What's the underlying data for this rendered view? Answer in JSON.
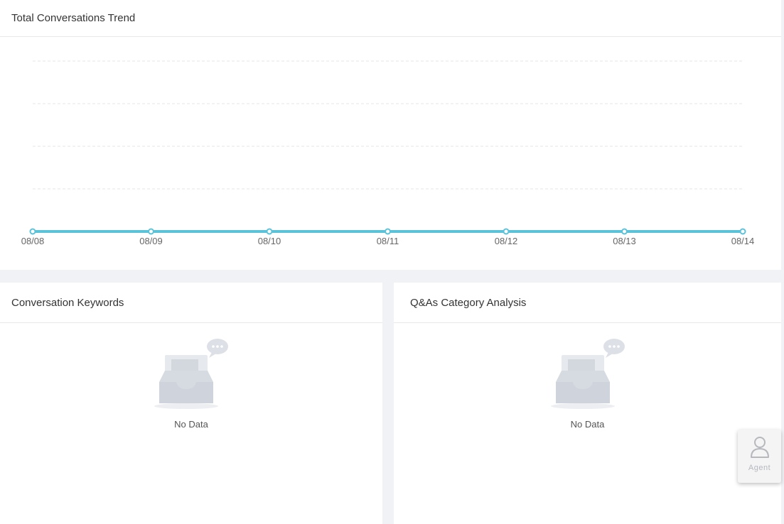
{
  "trend": {
    "title": "Total Conversations Trend"
  },
  "keywords": {
    "title": "Conversation Keywords",
    "empty_text": "No Data"
  },
  "qa": {
    "title": "Q&As Category Analysis",
    "empty_text": "No Data"
  },
  "agent": {
    "label": "Agent",
    "icon": "person-icon"
  },
  "colors": {
    "line": "#5bc3d9",
    "grid": "#e6e6e6",
    "tick_text": "#666666",
    "empty_icon": "#d6dbe2"
  },
  "chart_data": {
    "type": "line",
    "title": "Total Conversations Trend",
    "categories": [
      "08/08",
      "08/09",
      "08/10",
      "08/11",
      "08/12",
      "08/13",
      "08/14"
    ],
    "series": [
      {
        "values": [
          0,
          0,
          0,
          0,
          0,
          0,
          0
        ]
      }
    ],
    "ylim": [
      0,
      4
    ],
    "grid": true,
    "legend": "none"
  }
}
